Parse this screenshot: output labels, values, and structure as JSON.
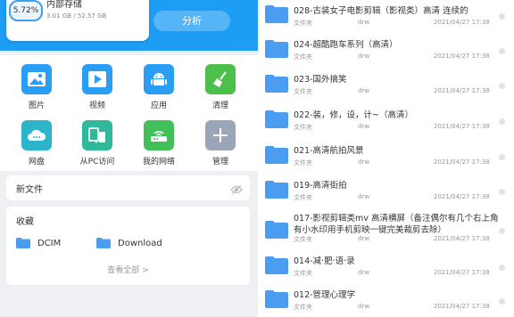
{
  "storage": {
    "title": "内部存储",
    "percent": "5.72%",
    "size": "3.01 GB / 52.57 GB",
    "hero_hint": "",
    "analyze_label": "分析"
  },
  "categories": [
    {
      "label": "图片",
      "icon": "image-icon",
      "color": "#2a9df4"
    },
    {
      "label": "视频",
      "icon": "video-icon",
      "color": "#2a9df4"
    },
    {
      "label": "应用",
      "icon": "android-icon",
      "color": "#2a9df4"
    },
    {
      "label": "清理",
      "icon": "broom-icon",
      "color": "#4cc04a"
    },
    {
      "label": "网盘",
      "icon": "cloud-icon",
      "color": "#2ab6c8"
    },
    {
      "label": "从PC访问",
      "icon": "pc-transfer-icon",
      "color": "#2fb89a"
    },
    {
      "label": "我的网络",
      "icon": "router-icon",
      "color": "#41c05a"
    },
    {
      "label": "管理",
      "icon": "plus-icon",
      "color": "#9aa6b8"
    }
  ],
  "new_files": {
    "label": "新文件"
  },
  "favorites": {
    "title": "收藏",
    "items": [
      {
        "label": "DCIM"
      },
      {
        "label": "Download"
      }
    ],
    "see_all": "查看全部 >"
  },
  "folder_list": [
    {
      "name": "028-古装女子电影剪辑（影视类）高清  连续的",
      "type": "文件夹",
      "owner": "drw",
      "date": "2021/04/27 17:38"
    },
    {
      "name": "024-超酷跑车系列（高清）",
      "type": "文件夹",
      "owner": "drw",
      "date": "2021/04/27 17:38"
    },
    {
      "name": "023-国外搞笑",
      "type": "文件夹",
      "owner": "drw",
      "date": "2021/04/27 17:38"
    },
    {
      "name": "022-装，修，设，计~（高清）",
      "type": "文件夹",
      "owner": "drw",
      "date": "2021/04/27 17:38"
    },
    {
      "name": "021-高清航拍风景",
      "type": "文件夹",
      "owner": "drw",
      "date": "2021/04/27 17:38"
    },
    {
      "name": "019-高清街拍",
      "type": "文件夹",
      "owner": "drw",
      "date": "2021/04/27 17:38"
    },
    {
      "name": "017-影视剪辑类mv  高清横屏（备注偶尔有几个右上角有小水印用手机剪映一键完美裁剪去除）",
      "type": "文件夹",
      "owner": "drw",
      "date": "2021/04/27 17:38"
    },
    {
      "name": "014-减·肥·语·录",
      "type": "文件夹",
      "owner": "drw",
      "date": "2021/04/27 17:38"
    },
    {
      "name": "012-管理心理学",
      "type": "文件夹",
      "owner": "drw",
      "date": "2021/04/27 17:38"
    }
  ]
}
